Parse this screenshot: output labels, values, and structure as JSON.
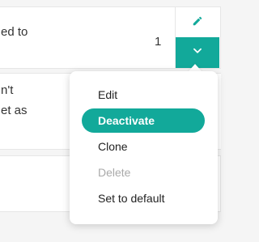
{
  "card1": {
    "text": "ed to",
    "count": "1"
  },
  "card2": {
    "line1": "n't",
    "line2": "et as"
  },
  "actions": {
    "edit_icon": "pencil-icon",
    "expand_icon": "chevron-down-icon",
    "accent_color": "#12a99a"
  },
  "menu": {
    "items": [
      {
        "label": "Edit",
        "state": "normal"
      },
      {
        "label": "Deactivate",
        "state": "active"
      },
      {
        "label": "Clone",
        "state": "normal"
      },
      {
        "label": "Delete",
        "state": "disabled"
      },
      {
        "label": "Set to default",
        "state": "normal"
      }
    ]
  }
}
